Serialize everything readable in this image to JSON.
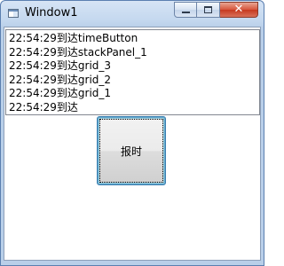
{
  "window": {
    "title": "Window1",
    "close_glyph": "✕"
  },
  "log": {
    "lines": [
      "22:54:29到达timeButton",
      "22:54:29到达stackPanel_1",
      "22:54:29到达grid_3",
      "22:54:29到达grid_2",
      "22:54:29到达grid_1",
      "22:54:29到达"
    ]
  },
  "main": {
    "report_button_label": "报时"
  }
}
